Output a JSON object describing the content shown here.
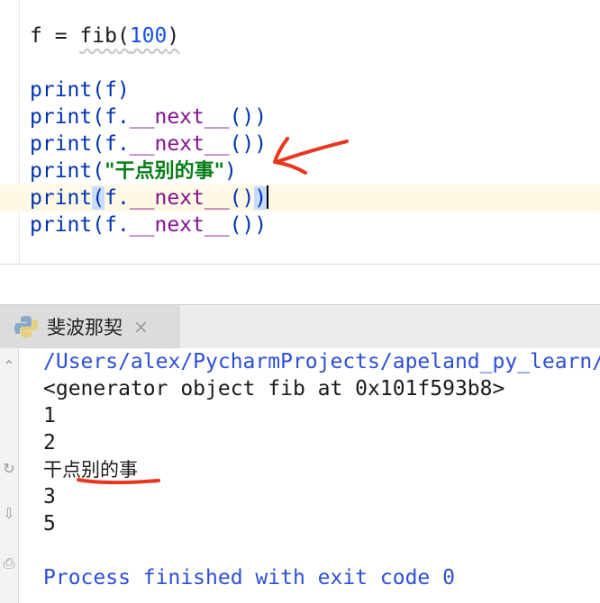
{
  "editor": {
    "lines": {
      "l1": {
        "var": "f",
        "eq": " = ",
        "fn": "fib",
        "open": "(",
        "arg": "100",
        "close": ")"
      },
      "l2": {
        "fn": "print",
        "open": "(",
        "arg": "f",
        "close": ")"
      },
      "l3": {
        "fn": "print",
        "open": "(f.",
        "method": "__next__",
        "close": "())"
      },
      "l4": {
        "fn": "print",
        "open": "(f.",
        "method": "__next__",
        "close": "())"
      },
      "l5": {
        "fn": "print",
        "open": "(",
        "str": "\"干点别的事\"",
        "close": ")"
      },
      "l6": {
        "fn": "print",
        "open": "(",
        "mid": "f.",
        "method": "__next__",
        "tail": "()",
        "close": ")"
      },
      "l7": {
        "fn": "print",
        "open": "(f.",
        "method": "__next__",
        "close": "())"
      }
    }
  },
  "run_panel": {
    "tab_label": "斐波那契",
    "close_glyph": "×",
    "icons": [
      "python-icon",
      "close-icon",
      "up-icon",
      "rerun-icon",
      "scroll-to-end-icon",
      "print-icon"
    ]
  },
  "console": {
    "lines": [
      "/Users/alex/PycharmProjects/apeland_py_learn/",
      "<generator object fib at 0x101f593b8>",
      "1",
      "2",
      "干点别的事",
      "3",
      "5",
      "",
      "Process finished with exit code 0"
    ]
  },
  "colors": {
    "keyword_blue": "#0033b3",
    "magic_method": "#871094",
    "string_green": "#067d17",
    "annotation_red": "#e8371e"
  }
}
